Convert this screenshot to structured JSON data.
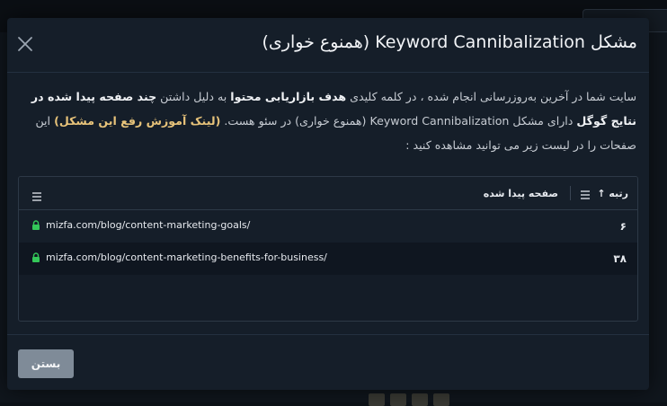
{
  "modal": {
    "title": "مشکل Keyword Cannibalization (همنوع خواری)",
    "body": {
      "p1": "سایت شما در آخرین به‌روزرسانی انجام شده ، در کلمه کلیدی ",
      "b1": "هدف بازاریابی محتوا",
      "p2": " به دلیل داشتن ",
      "b2": "چند صفحه پیدا شده در نتایج گوگل",
      "p3": " دارای مشکل Keyword Cannibalization (همنوع خواری) در سئو هست. ",
      "link": "(لینک آموزش رفع این مشکل)",
      "p4": " این صفحات را در لیست زیر می توانید مشاهده کنید :"
    },
    "table": {
      "headers": {
        "rank": "رتبه ↑",
        "page": "صفحه پیدا شده"
      },
      "rows": [
        {
          "rank": "۶",
          "url": "mizfa.com/blog/content-marketing-goals/"
        },
        {
          "rank": "۳۸",
          "url": "mizfa.com/blog/content-marketing-benefits-for-business/"
        }
      ]
    },
    "close_button": "بستن"
  },
  "colors": {
    "background": "#10161d",
    "modal": "#151e29",
    "accent_link": "#e7c37a",
    "lock_green": "#34c759",
    "button": "#7f8b98"
  },
  "icons": {
    "close": "close-icon",
    "sort": "sort-icon",
    "menu": "menu-icon",
    "lock": "lock-icon"
  }
}
